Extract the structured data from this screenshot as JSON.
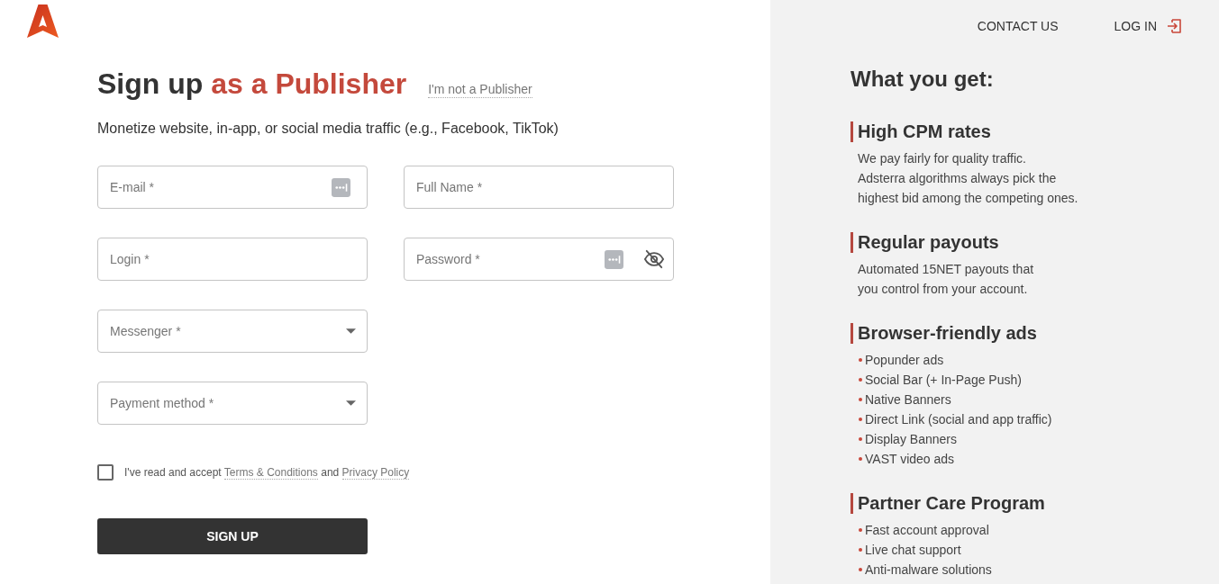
{
  "header": {
    "nav": [
      {
        "label": "CONTACT US",
        "kind": "plain"
      },
      {
        "label": "LOG IN",
        "kind": "login"
      }
    ]
  },
  "signup": {
    "title": [
      {
        "text": "Sign up",
        "accent": false
      },
      {
        "text": "as a Publisher",
        "accent": true
      }
    ],
    "switch_link": "I'm not a Publisher",
    "subtitle": "Monetize website, in-app, or social media traffic (e.g., Facebook, TikTok)",
    "rows": [
      [
        {
          "kind": "email",
          "placeholder": "E-mail *"
        },
        {
          "kind": "text",
          "placeholder": "Full Name *"
        }
      ],
      [
        {
          "kind": "text",
          "placeholder": "Login *"
        },
        {
          "kind": "password",
          "placeholder": "Password *"
        }
      ],
      [
        {
          "kind": "select",
          "placeholder": "Messenger *"
        }
      ],
      [
        {
          "kind": "select",
          "placeholder": "Payment method *"
        }
      ]
    ],
    "consent": {
      "checked": false,
      "parts": [
        {
          "kind": "text",
          "text": "I've read and accept"
        },
        {
          "kind": "link",
          "text": "Terms & Conditions"
        },
        {
          "kind": "text",
          "text": "and"
        },
        {
          "kind": "link",
          "text": "Privacy Policy"
        }
      ]
    },
    "submit": "SIGN UP"
  },
  "benefits": {
    "title": "What you get:",
    "sections": [
      {
        "title": "High CPM rates",
        "kind": "paragraph",
        "lines": [
          "We pay fairly for quality traffic.",
          "Adsterra algorithms always pick the",
          "highest bid among the competing ones."
        ]
      },
      {
        "title": "Regular payouts",
        "kind": "paragraph",
        "lines": [
          "Automated 15NET payouts that",
          "you control from your account."
        ]
      },
      {
        "title": "Browser-friendly ads",
        "kind": "list",
        "items": [
          "Popunder ads",
          "Social Bar (+ In-Page Push)",
          "Native Banners",
          "Direct Link (social and app traffic)",
          "Display Banners",
          "VAST video ads"
        ]
      },
      {
        "title": "Partner Care Program",
        "kind": "list",
        "items": [
          "Fast account approval",
          "Live chat support",
          "Anti-malware solutions"
        ]
      }
    ]
  }
}
